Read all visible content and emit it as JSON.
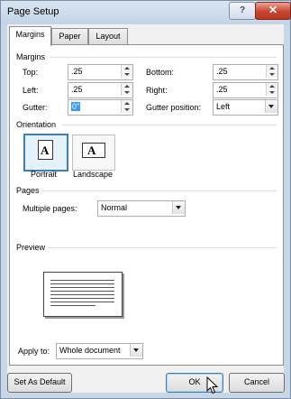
{
  "window": {
    "title": "Page Setup",
    "help_label": "?",
    "close_label": "✕"
  },
  "tabs": [
    {
      "label": "Margins",
      "active": true
    },
    {
      "label": "Paper",
      "active": false
    },
    {
      "label": "Layout",
      "active": false
    }
  ],
  "margins": {
    "group_label": "Margins",
    "top": {
      "label": "Top:",
      "value": ".25"
    },
    "left": {
      "label": "Left:",
      "value": ".25"
    },
    "gutter": {
      "label": "Gutter:",
      "value": "0\""
    },
    "bottom": {
      "label": "Bottom:",
      "value": ".25"
    },
    "right": {
      "label": "Right:",
      "value": ".25"
    },
    "gutter_position": {
      "label": "Gutter position:",
      "value": "Left"
    }
  },
  "orientation": {
    "group_label": "Orientation",
    "portrait": {
      "label": "Portrait",
      "selected": true
    },
    "landscape": {
      "label": "Landscape",
      "selected": false
    },
    "icon_letter": "A"
  },
  "pages": {
    "group_label": "Pages",
    "multiple_pages": {
      "label": "Multiple pages:",
      "value": "Normal"
    }
  },
  "preview": {
    "group_label": "Preview"
  },
  "apply_to": {
    "label": "Apply to:",
    "value": "Whole document"
  },
  "buttons": {
    "set_as_default": "Set As Default",
    "ok": "OK",
    "cancel": "Cancel"
  },
  "colors": {
    "selection_blue": "#3399ff",
    "selected_border": "#3c7fb1",
    "close_red": "#c7442f"
  }
}
